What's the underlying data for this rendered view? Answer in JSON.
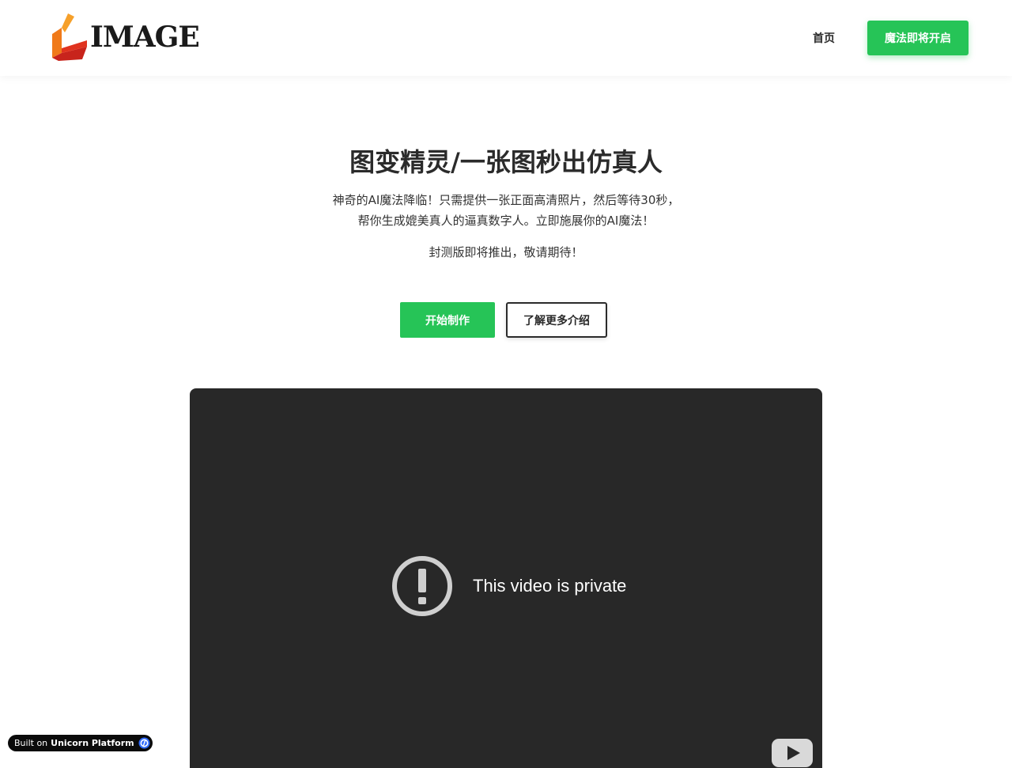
{
  "header": {
    "logo_text": "IMAGE",
    "nav_home": "首页",
    "cta_label": "魔法即将开启"
  },
  "hero": {
    "title": "图变精灵/一张图秒出仿真人",
    "description": "神奇的AI魔法降临！只需提供一张正面高清照片，然后等待30秒，帮你生成媲美真人的逼真数字人。立即施展你的AI魔法！",
    "note": "封测版即将推出，敬请期待！",
    "primary_button": "开始制作",
    "secondary_button": "了解更多介绍"
  },
  "video": {
    "message": "This video is private",
    "icons": [
      "alert-icon",
      "youtube-icon"
    ]
  },
  "badge": {
    "prefix": "Built on",
    "brand": "Unicorn Platform"
  },
  "colors": {
    "accent": "#26c457",
    "video_bg": "#282828",
    "text": "#2b2b2b"
  }
}
